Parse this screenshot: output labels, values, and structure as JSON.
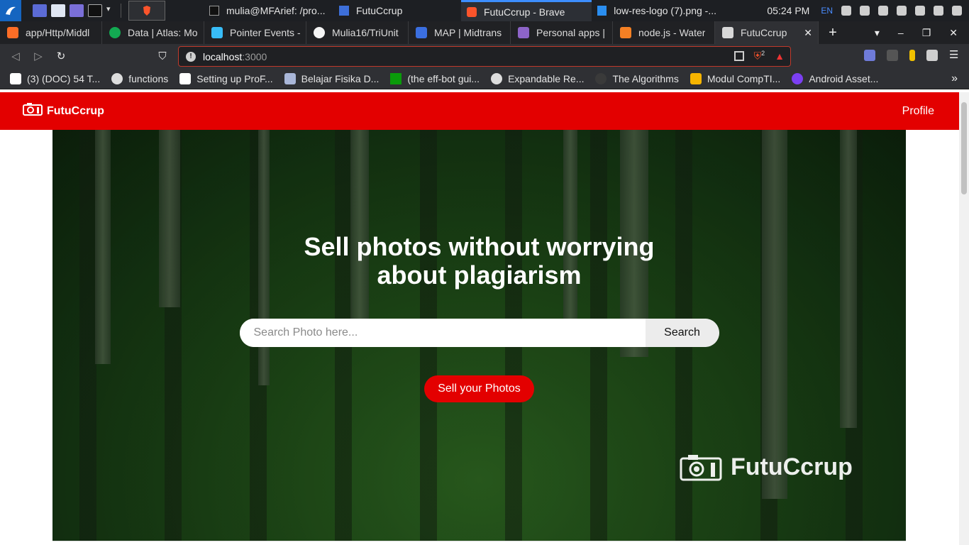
{
  "taskbar": {
    "tasks": [
      {
        "label": "mulia@MFArief: /pro..."
      },
      {
        "label": "FutuCcrup"
      },
      {
        "label": "FutuCcrup - Brave"
      },
      {
        "label": "low-res-logo (7).png -..."
      }
    ],
    "clock": "05:24 PM",
    "lang": "EN"
  },
  "browser": {
    "tabs": [
      {
        "label": "app/Http/Middl"
      },
      {
        "label": "Data | Atlas: Mo"
      },
      {
        "label": "Pointer Events -"
      },
      {
        "label": "Mulia16/TriUnit"
      },
      {
        "label": "MAP | Midtrans"
      },
      {
        "label": "Personal apps |"
      },
      {
        "label": "node.js - Water"
      },
      {
        "label": "FutuCcrup"
      }
    ],
    "active_tab_close": "✕",
    "new_tab": "+",
    "address": {
      "host": "localhost",
      "port": ":3000"
    },
    "shield_count": "2",
    "bookmarks": [
      {
        "label": "(3) (DOC) 54 T..."
      },
      {
        "label": "functions"
      },
      {
        "label": "Setting up ProF..."
      },
      {
        "label": "Belajar Fisika D..."
      },
      {
        "label": "(the eff-bot gui..."
      },
      {
        "label": "Expandable Re..."
      },
      {
        "label": "The Algorithms"
      },
      {
        "label": "Modul CompTI..."
      },
      {
        "label": "Android Asset..."
      }
    ],
    "bookmarks_more": "»"
  },
  "page": {
    "brand": "FutuCcrup",
    "nav_profile": "Profile",
    "hero_title": "Sell photos without worrying about plagiarism",
    "search": {
      "placeholder": "Search Photo here...",
      "value": "",
      "button": "Search"
    },
    "sell_button": "Sell your Photos",
    "watermark": "FutuCcrup"
  },
  "colors": {
    "brand_red": "#e30000",
    "taskbar": "#1d1f23",
    "toolbar": "#2f3034"
  }
}
